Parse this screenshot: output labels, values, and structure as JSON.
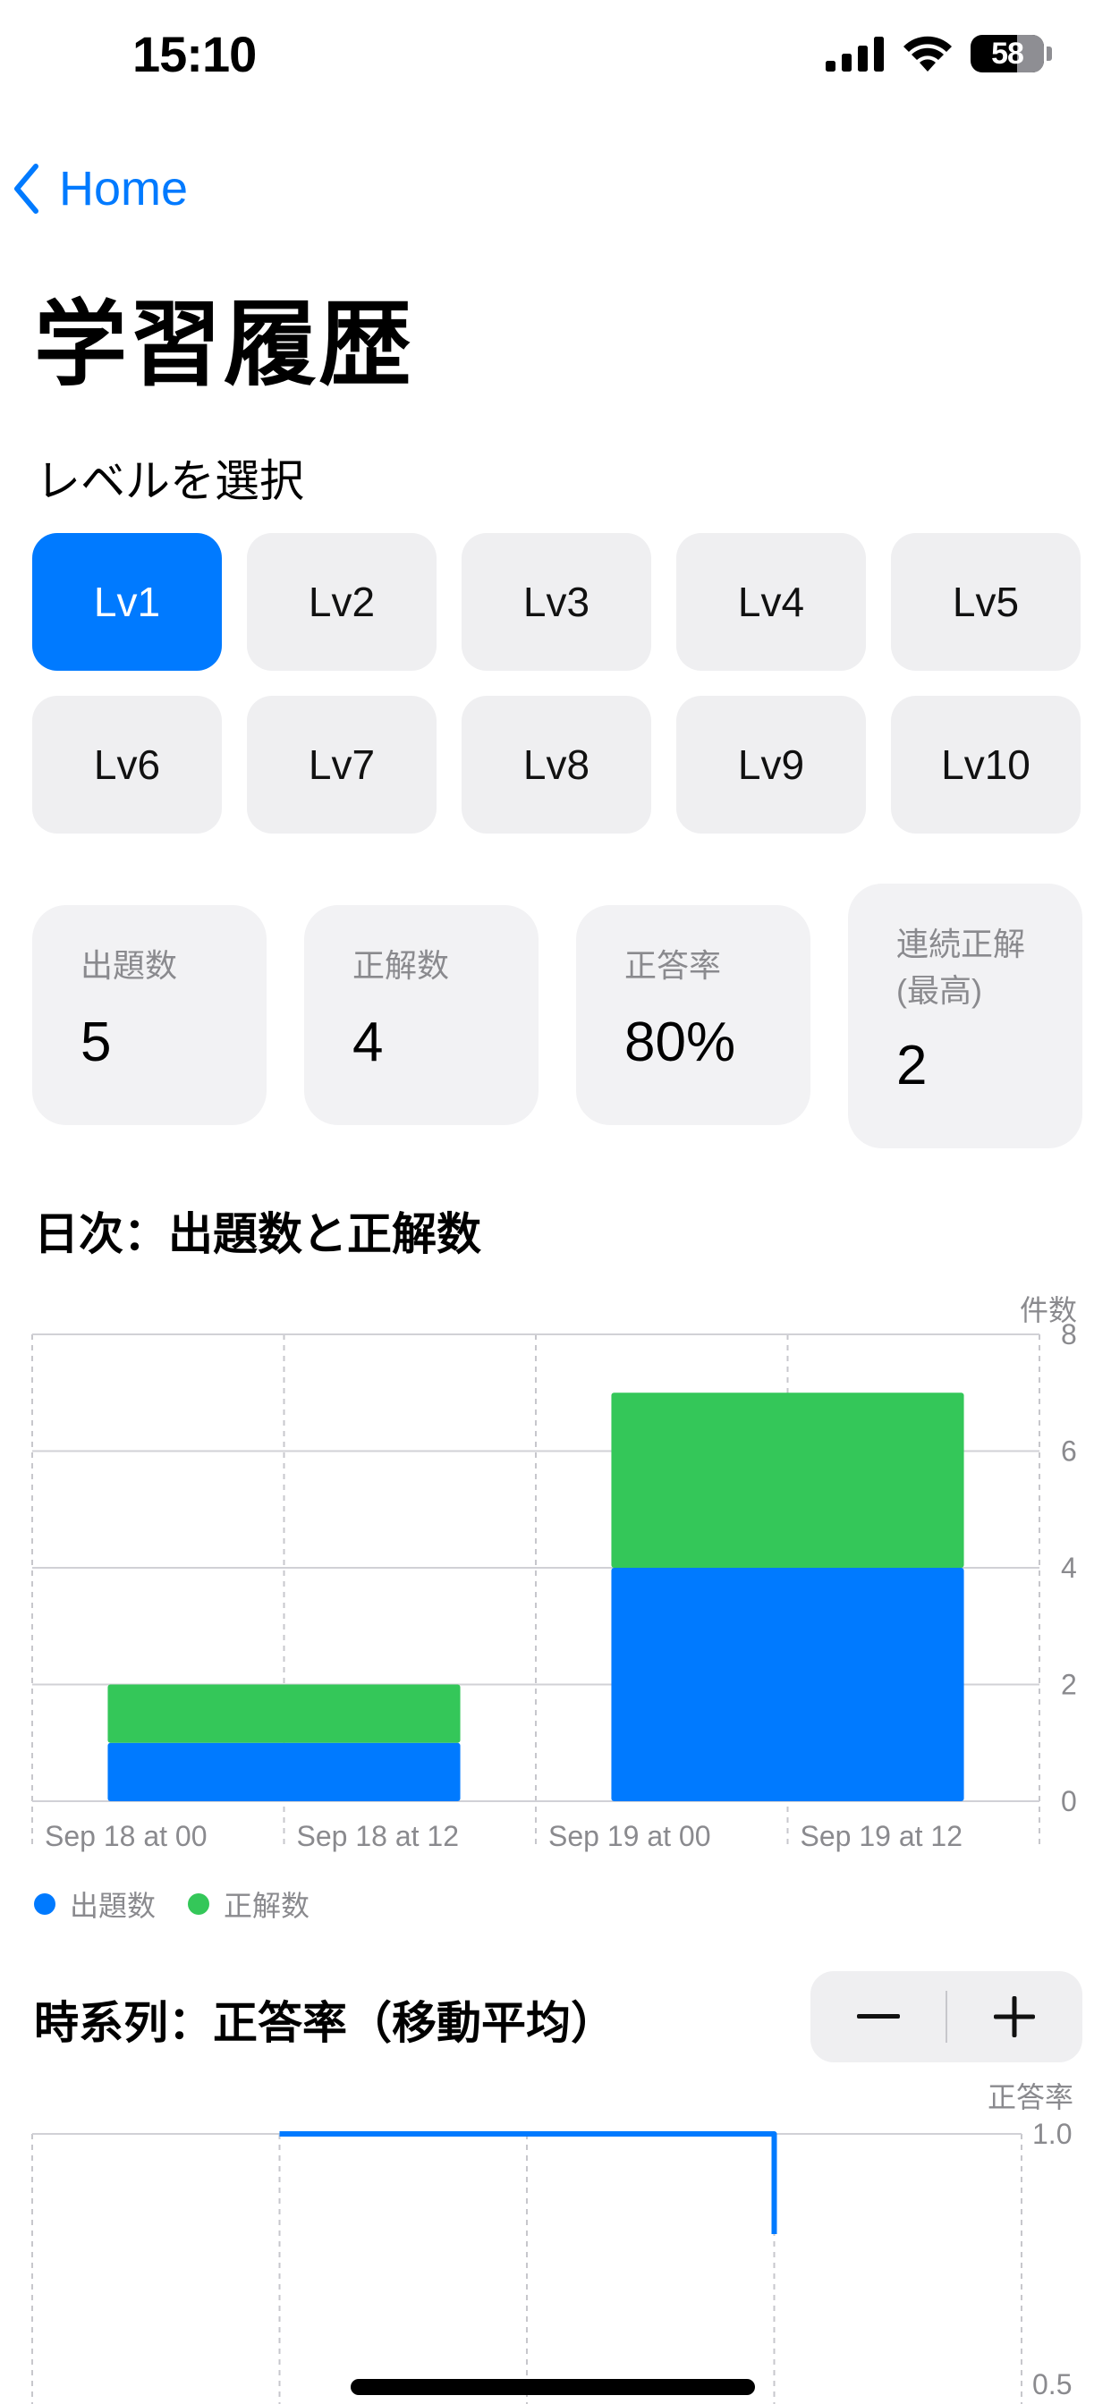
{
  "status_bar": {
    "time": "15:10",
    "battery": "58"
  },
  "nav": {
    "back_label": "Home"
  },
  "page": {
    "title": "学習履歴"
  },
  "level_select": {
    "label": "レベルを選択",
    "levels": [
      "Lv1",
      "Lv2",
      "Lv3",
      "Lv4",
      "Lv5",
      "Lv6",
      "Lv7",
      "Lv8",
      "Lv9",
      "Lv10"
    ],
    "selected": "Lv1"
  },
  "stats": [
    {
      "label": "出題数",
      "value": "5"
    },
    {
      "label": "正解数",
      "value": "4"
    },
    {
      "label": "正答率",
      "value": "80%"
    },
    {
      "label": "連続正解\n(最高)",
      "value": "2"
    }
  ],
  "daily_chart": {
    "title": "日次：出題数と正解数",
    "y_axis_title": "件数",
    "legend": [
      "出題数",
      "正解数"
    ]
  },
  "timeseries_chart": {
    "title": "時系列：正答率（移動平均）",
    "y_axis_title": "正答率",
    "stepper": {
      "minus": "−",
      "plus": "+"
    }
  },
  "colors": {
    "accent": "#007aff",
    "correct": "#34c759",
    "card_bg": "#f2f2f4"
  },
  "chart_data": [
    {
      "type": "bar",
      "stacked": true,
      "title": "日次：出題数と正解数",
      "ylabel": "件数",
      "categories": [
        "Sep 18",
        "Sep 19"
      ],
      "x_tick_labels": [
        "Sep 18 at 00",
        "Sep 18 at 12",
        "Sep 19 at 00",
        "Sep 19 at 12"
      ],
      "series": [
        {
          "name": "出題数",
          "values": [
            1,
            4
          ],
          "color": "#007aff"
        },
        {
          "name": "正解数",
          "values": [
            1,
            3
          ],
          "color": "#34c759"
        }
      ],
      "ylim": [
        0,
        8
      ],
      "y_ticks": [
        0,
        2,
        4,
        6,
        8
      ],
      "grid": true,
      "legend_position": "bottom-left"
    },
    {
      "type": "line",
      "title": "時系列：正答率（移動平均）",
      "ylabel": "正答率",
      "x_gridlines": 4,
      "points": [
        {
          "x": 1,
          "y": 1.0
        },
        {
          "x": 2,
          "y": 1.0
        },
        {
          "x": 3,
          "y": 1.0
        },
        {
          "x": 3,
          "y": 0.8
        }
      ],
      "y_ticks": [
        0.5,
        1.0
      ],
      "y_tick_labels": [
        "0.5",
        "1.0"
      ],
      "color": "#007aff",
      "grid": true
    }
  ]
}
